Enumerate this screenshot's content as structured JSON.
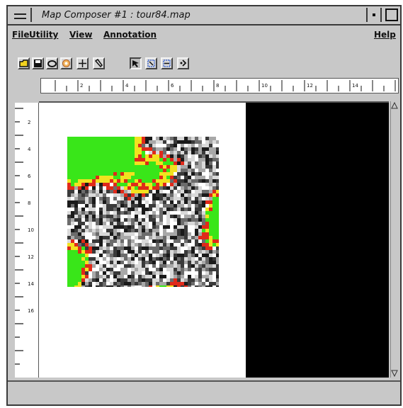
{
  "window": {
    "title": "Map Composer #1 : tour84.map"
  },
  "menubar": {
    "items": [
      {
        "label": "File"
      },
      {
        "label": "Utility"
      },
      {
        "label": "View"
      },
      {
        "label": "Annotation"
      },
      {
        "label": "Help"
      }
    ]
  },
  "toolbar": {
    "icons": [
      "open-folder-icon",
      "save-icon",
      "print-icon",
      "color-icon",
      "add-icon",
      "tool-icon",
      "select-arrow-icon",
      "zoom-in-icon",
      "zoom-out-icon",
      "refresh-icon"
    ],
    "active_icon": "select-arrow-icon"
  },
  "rulers": {
    "horizontal_ticks": [
      "2",
      "4",
      "6",
      "8",
      "10",
      "12",
      "14"
    ],
    "vertical_ticks": [
      "2",
      "4",
      "6",
      "8",
      "10",
      "12",
      "14",
      "16"
    ]
  },
  "status": {
    "text": ""
  },
  "colors": {
    "chrome": "#c8c8c8",
    "pane_black": "#000000",
    "map_green": "#39e619",
    "map_red": "#e02a1a",
    "map_yellow": "#f2e21f",
    "map_gray": "#8a8a8a"
  }
}
